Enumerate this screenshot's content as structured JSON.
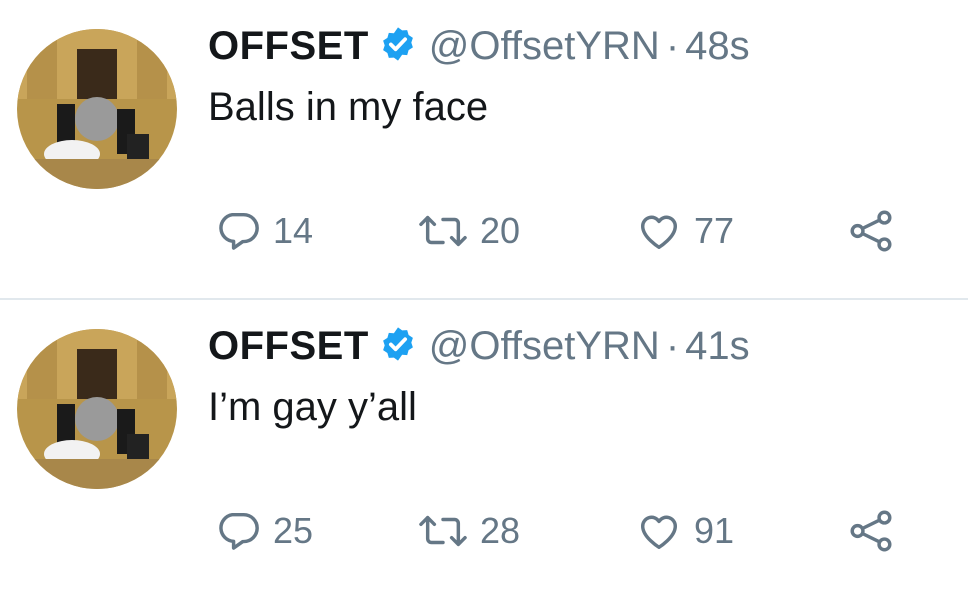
{
  "tweets": [
    {
      "name": "OFFSET",
      "handle": "@OffsetYRN",
      "separator": "·",
      "time": "48s",
      "text": "Balls in my face",
      "replies": "14",
      "retweets": "20",
      "likes": "77"
    },
    {
      "name": "OFFSET",
      "handle": "@OffsetYRN",
      "separator": "·",
      "time": "41s",
      "text": "I’m gay y’all",
      "replies": "25",
      "retweets": "28",
      "likes": "91"
    }
  ],
  "colors": {
    "verified": "#1da1f2",
    "text": "#14171a",
    "muted": "#657786",
    "divider": "#e1e8ed"
  },
  "icons": [
    "verified-badge-icon",
    "reply-icon",
    "retweet-icon",
    "like-icon",
    "share-icon"
  ]
}
